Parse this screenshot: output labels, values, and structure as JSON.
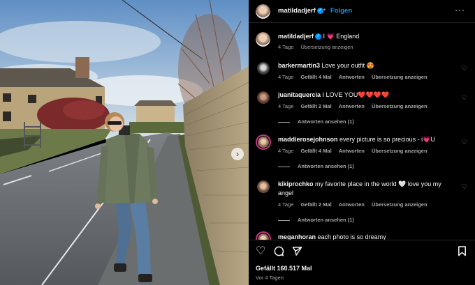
{
  "header": {
    "username": "matildadjerf",
    "separator": "•",
    "follow_label": "Folgen",
    "more_label": "···"
  },
  "caption": {
    "username": "matildadjerf",
    "text_before": "I ",
    "emoji": "💗",
    "text_after": " England",
    "age": "4 Tage",
    "translate": "Übersetzung anzeigen"
  },
  "comments": [
    {
      "username": "barkermartin3",
      "text": "Love your outfit 😍",
      "age": "4 Tage",
      "likes": "Gefällt 4 Mal",
      "reply": "Antworten",
      "translate": "Übersetzung anzeigen",
      "view_replies": ""
    },
    {
      "username": "juanitaquercia",
      "text": "I LOVE YOU❤️❤️❤️❤️",
      "age": "4 Tage",
      "likes": "Gefällt 2 Mal",
      "reply": "Antworten",
      "translate": "Übersetzung anzeigen",
      "view_replies": "Antworten ansehen (1)"
    },
    {
      "username": "maddierosejohnson",
      "text": "every picture is so precious - i💗U",
      "age": "4 Tage",
      "likes": "Gefällt 4 Mal",
      "reply": "Antworten",
      "translate": "Übersetzung anzeigen",
      "view_replies": "Antworten ansehen (1)"
    },
    {
      "username": "kikiprochko",
      "text": "my favorite place in the world 🤍 love you my angel",
      "age": "4 Tage",
      "likes": "Gefällt 2 Mal",
      "reply": "Antworten",
      "translate": "Übersetzung anzeigen",
      "view_replies": "Antworten ansehen (1)"
    },
    {
      "username": "meganhoran",
      "text": "each photo is so dreamy",
      "age": "",
      "likes": "",
      "reply": "",
      "translate": "",
      "view_replies": ""
    }
  ],
  "footer": {
    "likes": "Gefällt 160.517 Mal",
    "time": "Vor 4 Tagen"
  },
  "icons": {
    "heart_outline": "♡",
    "comment": "◯",
    "share": "➤",
    "bookmark": "bookmark-icon",
    "next": "›"
  },
  "colors": {
    "accent": "#0095f6",
    "background": "#000000",
    "secondary_text": "#a8a8a8",
    "story_ring": "#c13584"
  }
}
